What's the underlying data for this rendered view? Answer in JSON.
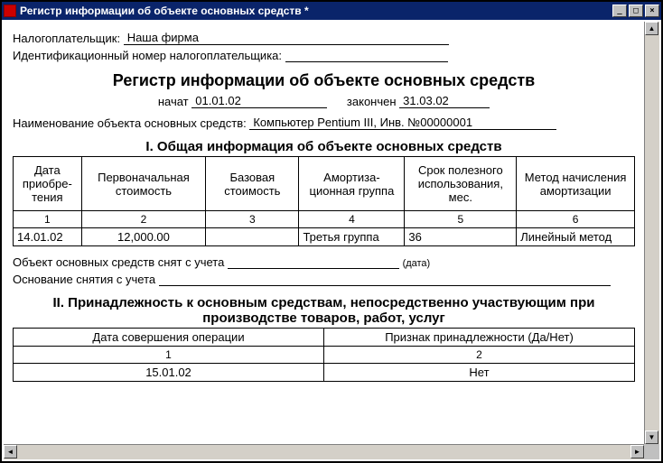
{
  "window": {
    "title": "Регистр информации об объекте основных средств  *"
  },
  "fields": {
    "taxpayer_label": "Налогоплательщик:",
    "taxpayer_value": "Наша фирма",
    "taxpayer_id_label": "Идентификационный номер налогоплательщика:",
    "taxpayer_id_value": "",
    "heading": "Регистр информации об объекте основных средств",
    "started_label": "начат",
    "started_value": "01.01.02",
    "ended_label": "закончен",
    "ended_value": "31.03.02",
    "asset_name_label": "Наименование объекта основных средств:",
    "asset_name_value": "Компьютер Pentium III, Инв. №00000001",
    "deregister_label": "Объект основных средств снят с учета",
    "deregister_value": "",
    "deregister_hint": "(дата)",
    "basis_label": "Основание снятия с учета",
    "basis_value": ""
  },
  "section1": {
    "title": "I. Общая информация об объекте основных средств",
    "headers": [
      "Дата приобре-тения",
      "Первоначальная стоимость",
      "Базовая стоимость",
      "Амортиза-ционная группа",
      "Срок полезного использования, мес.",
      "Метод начисления амортизации"
    ],
    "nums": [
      "1",
      "2",
      "3",
      "4",
      "5",
      "6"
    ],
    "row": [
      "14.01.02",
      "12,000.00",
      "",
      "Третья группа",
      "36",
      "Линейный метод"
    ]
  },
  "section2": {
    "title": "II. Принадлежность к основным средствам, непосредственно участвующим при производстве товаров, работ, услуг",
    "headers": [
      "Дата совершения операции",
      "Признак принадлежности (Да/Нет)"
    ],
    "nums": [
      "1",
      "2"
    ],
    "row": [
      "15.01.02",
      "Нет"
    ]
  }
}
